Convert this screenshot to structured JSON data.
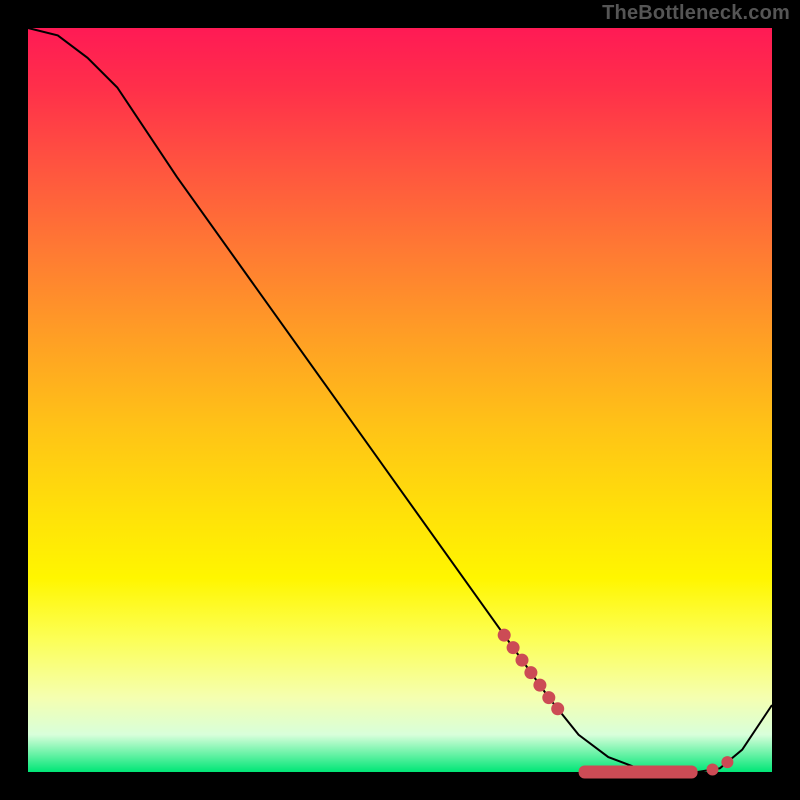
{
  "watermark": "TheBottleneck.com",
  "colors": {
    "background": "#000000",
    "curve": "#000000",
    "marker": "#cc4b55",
    "gradient_top": "#ff1a55",
    "gradient_bottom": "#00e676"
  },
  "chart_data": {
    "type": "line",
    "title": "",
    "xlabel": "",
    "ylabel": "",
    "xlim": [
      0,
      100
    ],
    "ylim": [
      0,
      100
    ],
    "series": [
      {
        "name": "bottleneck-curve",
        "x": [
          0,
          4,
          8,
          12,
          20,
          30,
          40,
          50,
          60,
          65,
          70,
          74,
          78,
          82,
          86,
          90,
          93,
          96,
          100
        ],
        "y": [
          100,
          99,
          96,
          92,
          80,
          66,
          52,
          38,
          24,
          17,
          10,
          5,
          2,
          0.5,
          0,
          0,
          0.5,
          3,
          9
        ]
      }
    ],
    "markers": {
      "left_cluster_x_range": [
        64,
        72
      ],
      "flat_pill_x_range": [
        74,
        90
      ],
      "right_dots_x": [
        92,
        94
      ],
      "y_at_markers": 0
    },
    "annotations": []
  }
}
